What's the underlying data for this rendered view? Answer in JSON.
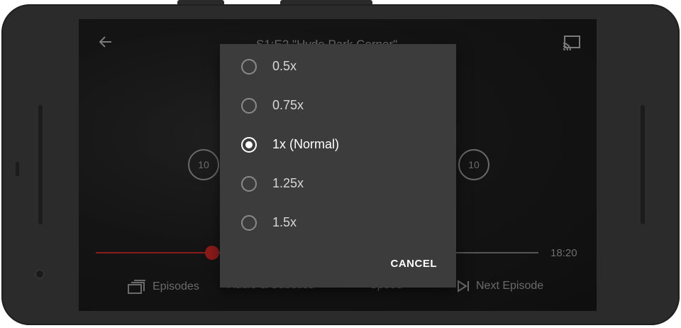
{
  "player": {
    "title": "S1:E2 \"Hyde Park Corner\"",
    "time_remaining": "18:20",
    "skip_back_label": "10",
    "skip_forward_label": "10",
    "progress": 0.26,
    "bottom_bar": {
      "episodes": "Episodes",
      "audio_subtitles": "Audio & Subtitles",
      "speed": "Speed",
      "next_episode": "Next Episode"
    }
  },
  "speed_dialog": {
    "options": [
      {
        "label": "0.5x",
        "selected": false
      },
      {
        "label": "0.75x",
        "selected": false
      },
      {
        "label": "1x (Normal)",
        "selected": true
      },
      {
        "label": "1.25x",
        "selected": false
      },
      {
        "label": "1.5x",
        "selected": false
      }
    ],
    "cancel_label": "CANCEL"
  },
  "colors": {
    "accent": "#e50914",
    "dialog_bg": "#3c3c3c"
  }
}
